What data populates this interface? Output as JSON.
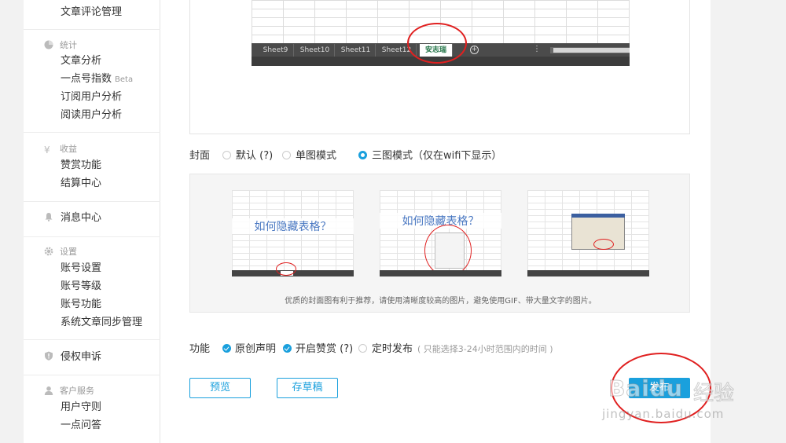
{
  "sidebar": {
    "top_item": "文章评论管理",
    "stats": {
      "heading": "统计",
      "items": [
        "文章分析",
        "一点号指数",
        "订阅用户分析",
        "阅读用户分析"
      ],
      "beta": "Beta"
    },
    "income": {
      "heading": "收益",
      "items": [
        "赞赏功能",
        "结算中心"
      ]
    },
    "message_center": "消息中心",
    "settings": {
      "heading": "设置",
      "items": [
        "账号设置",
        "账号等级",
        "账号功能",
        "系统文章同步管理"
      ]
    },
    "infringement": "侵权申诉",
    "service": {
      "heading": "客户服务",
      "items": [
        "用户守则",
        "一点问答"
      ]
    }
  },
  "sheet_preview": {
    "tabs": [
      "Sheet9",
      "Sheet10",
      "Sheet11",
      "Sheet12",
      "安志瑞"
    ],
    "active_tab": "安志瑞"
  },
  "cover": {
    "label": "封面",
    "options": [
      "默认 (?)",
      "单图模式",
      "三图模式（仅在wifi下显示）"
    ],
    "selected": "三图模式（仅在wifi下显示）",
    "thumb_titles": [
      "如何隐藏表格？",
      "如何隐藏表格？"
    ],
    "tip": "优质的封面图有利于推荐，请使用清晰度较高的图片，避免使用GIF、带大量文字的图片。"
  },
  "features": {
    "label": "功能",
    "original": "原创声明",
    "reward": "开启赞赏 (?)",
    "schedule": "定时发布",
    "schedule_hint": "( 只能选择3-24小时范围内的时间 )"
  },
  "actions": {
    "preview": "预览",
    "draft": "存草稿",
    "publish": "发布"
  },
  "watermark": {
    "brand": "Baidu",
    "brand_cn": "经验",
    "url": "jingyan.baidu.com"
  },
  "colors": {
    "accent": "#1aa0dd",
    "annotation": "#e02020",
    "excel_green": "#217346"
  }
}
